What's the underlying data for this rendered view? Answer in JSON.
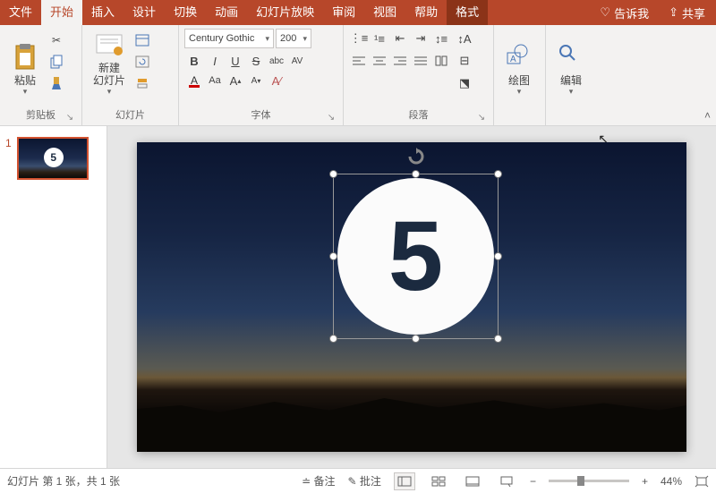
{
  "tabs": {
    "file": "文件",
    "home": "开始",
    "insert": "插入",
    "design": "设计",
    "transitions": "切换",
    "animations": "动画",
    "slideshow": "幻灯片放映",
    "review": "审阅",
    "view": "视图",
    "help": "帮助",
    "format": "格式",
    "tellme": "告诉我",
    "share": "共享"
  },
  "ribbon": {
    "clipboard": {
      "label": "剪贴板",
      "paste": "粘贴"
    },
    "slides": {
      "label": "幻灯片",
      "new": "新建\n幻灯片"
    },
    "font": {
      "label": "字体",
      "name": "Century Gothic",
      "size": "200",
      "bold": "B",
      "italic": "I",
      "underline": "U",
      "strike": "S",
      "shadow": "abc",
      "spacing": "AV",
      "caseChange": "Aa",
      "grow": "A",
      "shrink": "A",
      "clear": "A"
    },
    "paragraph": {
      "label": "段落"
    },
    "drawing": {
      "label": "绘图"
    },
    "editing": {
      "label": "编辑"
    }
  },
  "thumbnail": {
    "index": "1",
    "digit": "5"
  },
  "slide": {
    "digit": "5"
  },
  "status": {
    "slideinfo": "幻灯片 第 1 张，共 1 张",
    "notes": "备注",
    "comments": "批注",
    "zoom": "44%",
    "minus": "−",
    "plus": "+"
  }
}
